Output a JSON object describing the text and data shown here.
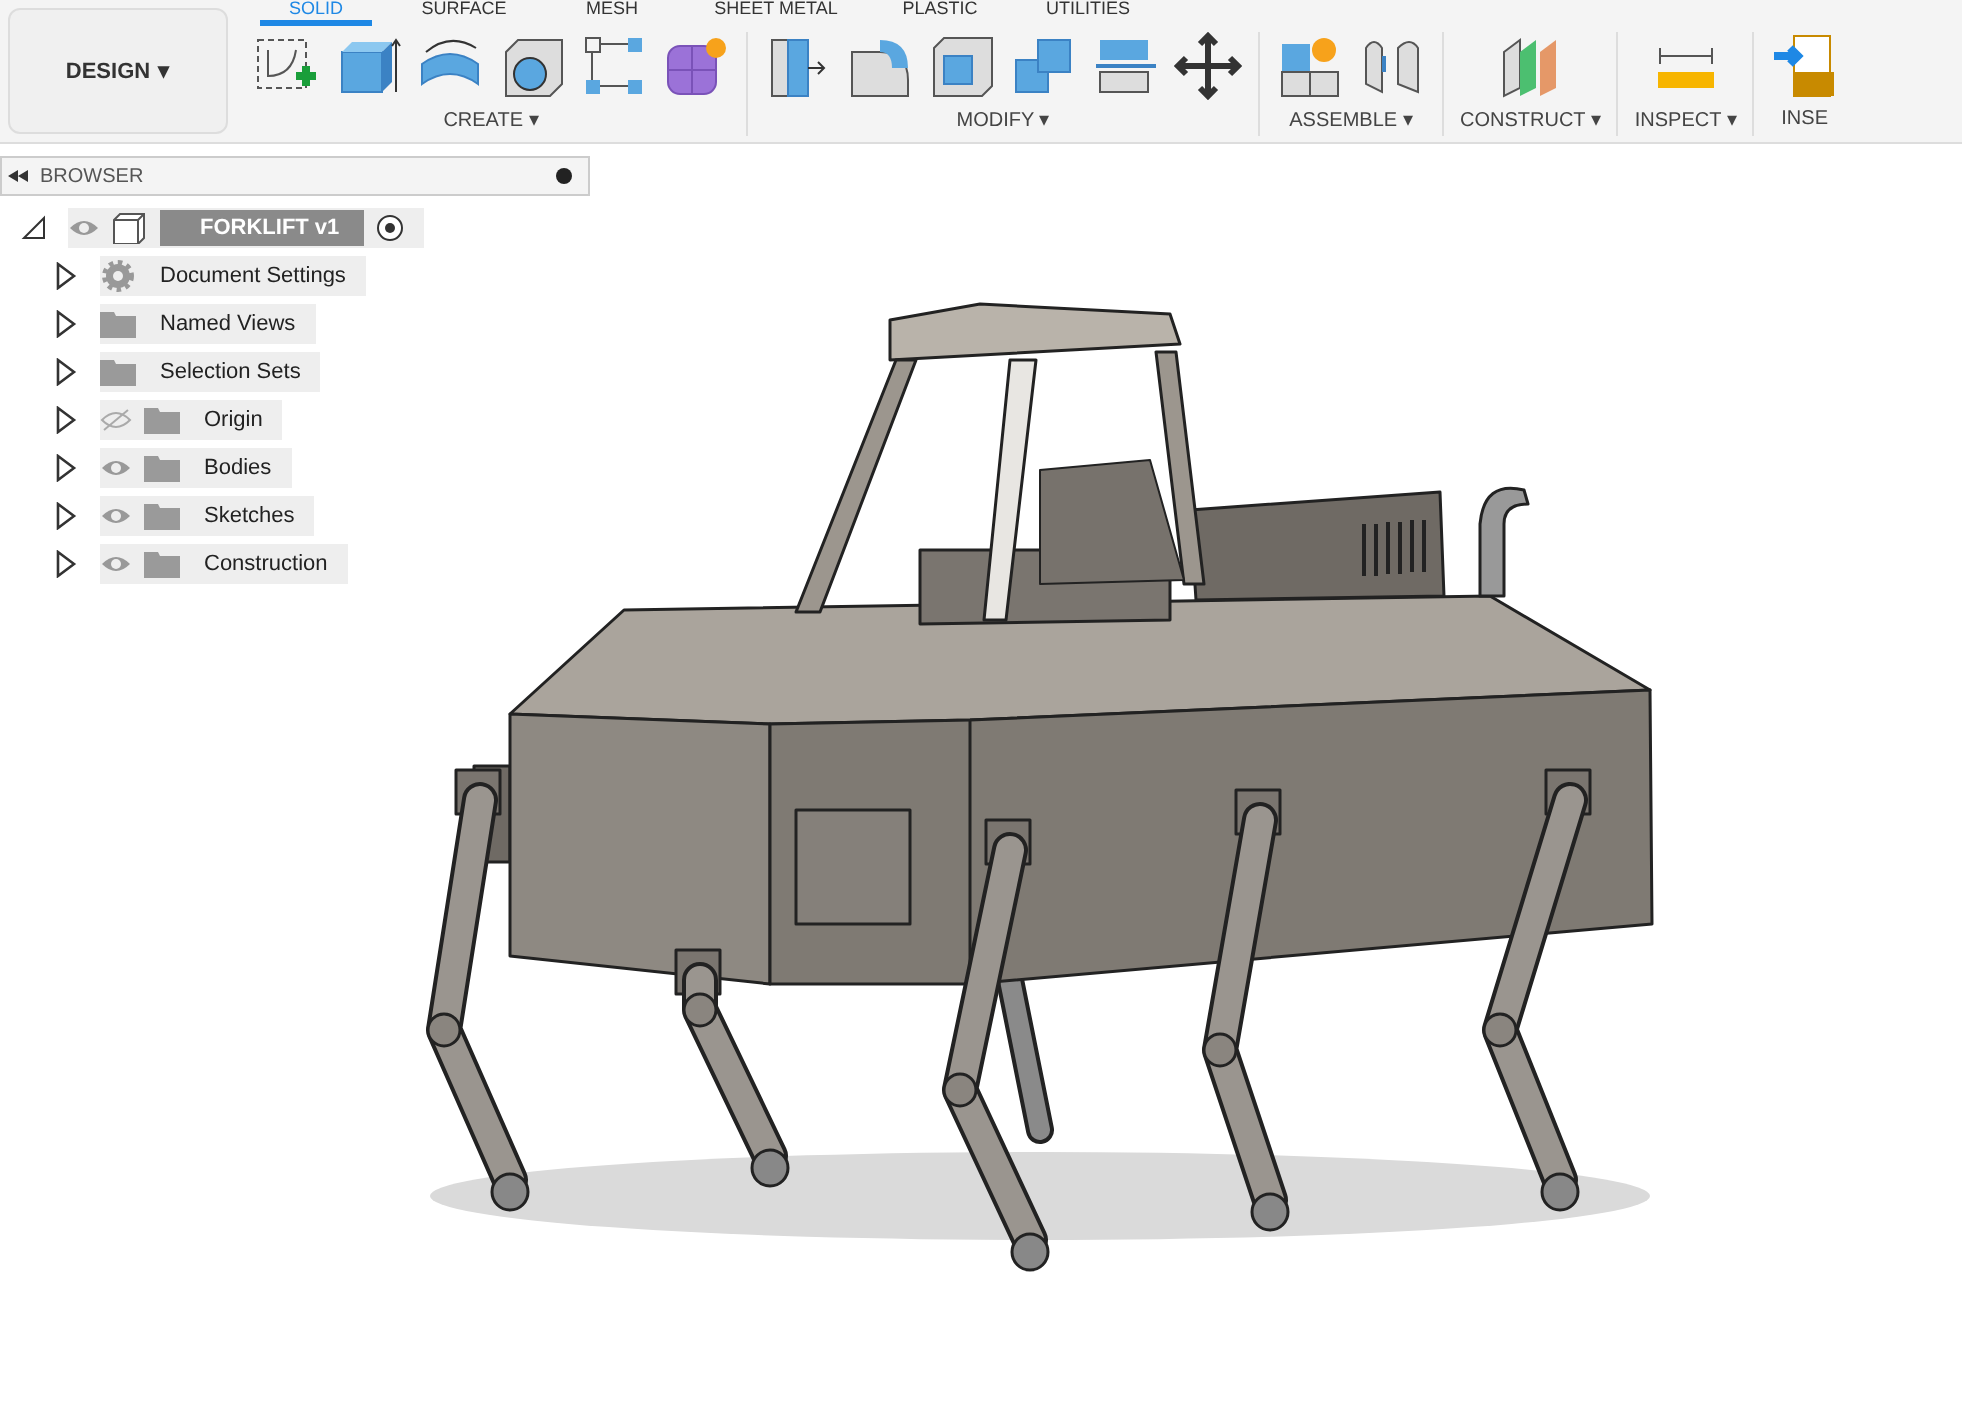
{
  "workspace_button": {
    "label": "DESIGN",
    "caret": "▾"
  },
  "tabs": [
    {
      "label": "SOLID",
      "selected": true
    },
    {
      "label": "SURFACE",
      "selected": false
    },
    {
      "label": "MESH",
      "selected": false
    },
    {
      "label": "SHEET METAL",
      "selected": false
    },
    {
      "label": "PLASTIC",
      "selected": false
    },
    {
      "label": "UTILITIES",
      "selected": false
    }
  ],
  "tool_groups": [
    {
      "label": "CREATE",
      "caret": "▾"
    },
    {
      "label": "MODIFY",
      "caret": "▾"
    },
    {
      "label": "ASSEMBLE",
      "caret": "▾"
    },
    {
      "label": "CONSTRUCT",
      "caret": "▾"
    },
    {
      "label": "INSPECT",
      "caret": "▾"
    },
    {
      "label": "INSE"
    }
  ],
  "browser": {
    "title": "BROWSER",
    "root": {
      "label": "FORKLIFT v1",
      "visible": true,
      "expanded": true,
      "children": [
        {
          "label": "Document Settings",
          "kind": "settings",
          "expanded": false
        },
        {
          "label": "Named Views",
          "kind": "folder",
          "expanded": false
        },
        {
          "label": "Selection Sets",
          "kind": "folder",
          "expanded": false
        },
        {
          "label": "Origin",
          "kind": "folder",
          "visible": false,
          "expanded": false
        },
        {
          "label": "Bodies",
          "kind": "folder",
          "visible": true,
          "expanded": false
        },
        {
          "label": "Sketches",
          "kind": "folder",
          "visible": true,
          "expanded": false
        },
        {
          "label": "Construction",
          "kind": "folder",
          "visible": true,
          "expanded": false
        }
      ]
    }
  }
}
